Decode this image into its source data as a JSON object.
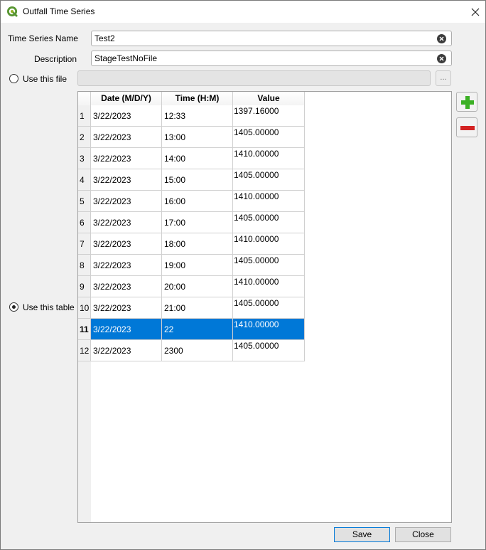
{
  "window": {
    "title": "Outfall Time Series",
    "accent_color": "#0078d7"
  },
  "form": {
    "name_label": "Time Series Name",
    "name_value": "Test2",
    "description_label": "Description",
    "description_value": "StageTestNoFile",
    "use_file_label": "Use this file",
    "use_file_checked": false,
    "browse_label": "...",
    "use_table_label": "Use this table",
    "use_table_checked": true
  },
  "table": {
    "columns": [
      "Date (M/D/Y)",
      "Time (H:M)",
      "Value"
    ],
    "rows": [
      {
        "num": "1",
        "date": "3/22/2023",
        "time": "12:33",
        "value": "1397.16000"
      },
      {
        "num": "2",
        "date": "3/22/2023",
        "time": "13:00",
        "value": "1405.00000"
      },
      {
        "num": "3",
        "date": "3/22/2023",
        "time": "14:00",
        "value": "1410.00000"
      },
      {
        "num": "4",
        "date": "3/22/2023",
        "time": "15:00",
        "value": "1405.00000"
      },
      {
        "num": "5",
        "date": "3/22/2023",
        "time": "16:00",
        "value": "1410.00000"
      },
      {
        "num": "6",
        "date": "3/22/2023",
        "time": "17:00",
        "value": "1405.00000"
      },
      {
        "num": "7",
        "date": "3/22/2023",
        "time": "18:00",
        "value": "1410.00000"
      },
      {
        "num": "8",
        "date": "3/22/2023",
        "time": "19:00",
        "value": "1405.00000"
      },
      {
        "num": "9",
        "date": "3/22/2023",
        "time": "20:00",
        "value": "1410.00000"
      },
      {
        "num": "10",
        "date": "3/22/2023",
        "time": "21:00",
        "value": "1405.00000"
      },
      {
        "num": "11",
        "date": "3/22/2023",
        "time": "22",
        "value": "1410.00000",
        "selected": true
      },
      {
        "num": "12",
        "date": "3/22/2023",
        "time": "2300",
        "value": "1405.00000"
      }
    ]
  },
  "side_buttons": {
    "add_icon": "plus-icon",
    "add_color": "#3cb025",
    "remove_icon": "minus-icon",
    "remove_color": "#d32222"
  },
  "buttons": {
    "save_label": "Save",
    "close_label": "Close"
  }
}
